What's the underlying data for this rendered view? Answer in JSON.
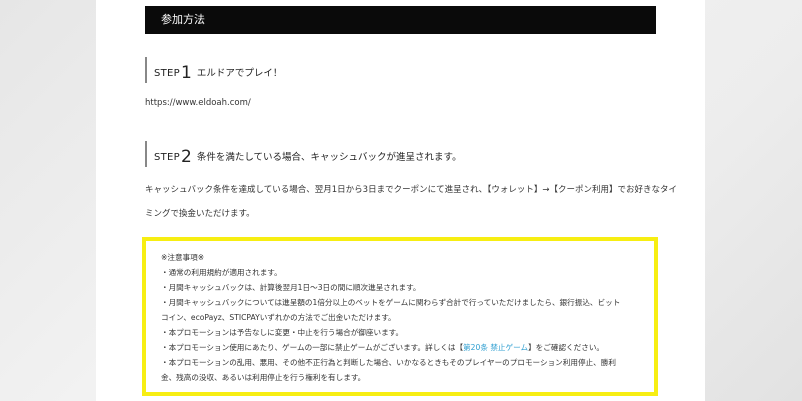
{
  "section": {
    "title": "参加方法"
  },
  "step1": {
    "label": "STEP",
    "number": "1",
    "text": "エルドアでプレイ！"
  },
  "url": "https://www.eldoah.com/",
  "step2": {
    "label": "STEP",
    "number": "2",
    "text": "条件を満たしている場合、キャッシュバックが進呈されます。"
  },
  "description": {
    "line1": "キャッシュバック条件を達成している場合、翌月1日から3日までクーポンにて進呈され、【ウォレット】→【クーポン利用】でお好きなタイ",
    "line2": "ミングで換金いただけます。"
  },
  "notice": {
    "heading": "※注意事項※",
    "l1": "・通常の利用規約が適用されます。",
    "l2": "・月間キャッシュバックは、計算後翌月1日～3日の間に順次進呈されます。",
    "l3": "・月間キャッシュバックについては進呈額の1倍分以上のベットをゲームに関わらず合計で行っていただけましたら、銀行振込、ビット",
    "l4": "コイン、ecoPayz、STICPAYいずれかの方法でご出金いただけます。",
    "l5": "・本プロモーションは予告なしに変更・中止を行う場合が御座います。",
    "l6_pre": "・本プロモーション使用にあたり、ゲームの一部に禁止ゲームがございます。詳しくは【",
    "l6_link": "第20条 禁止ゲーム",
    "l6_post": "】をご確認ください。",
    "l7": "・本プロモーションの乱用、悪用、その他不正行為と判断した場合、いかなるときもそのプレイヤーのプロモーション利用停止、勝利",
    "l8": "金、残高の没収、あるいは利用停止を行う権利を有します。",
    "border_color": "#f7ee12",
    "link_color": "#2f9fd1"
  }
}
